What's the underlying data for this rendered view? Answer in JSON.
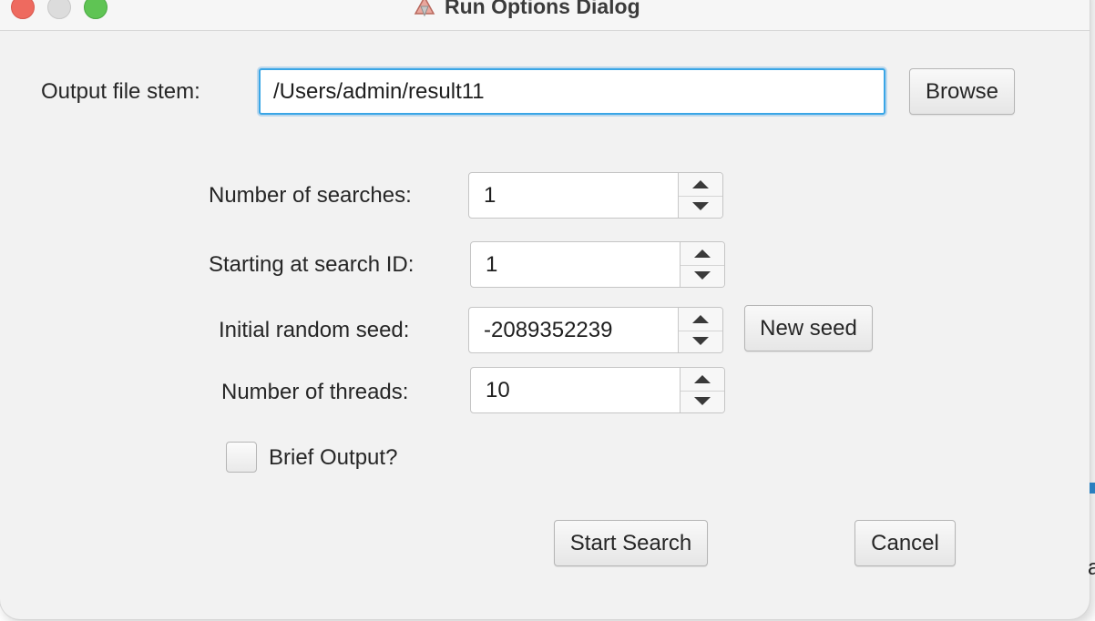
{
  "window": {
    "title": "Run Options Dialog",
    "title_icon": "dialog-app-icon"
  },
  "output_file_stem": {
    "label": "Output file stem:",
    "value": "/Users/admin/result11",
    "browse_label": "Browse"
  },
  "fields": {
    "num_searches": {
      "label": "Number of searches:",
      "value": "1"
    },
    "start_search_id": {
      "label": "Starting at search ID:",
      "value": "1"
    },
    "random_seed": {
      "label": "Initial random seed:",
      "value": "-2089352239",
      "new_seed_label": "New seed"
    },
    "num_threads": {
      "label": "Number of threads:",
      "value": "10"
    }
  },
  "brief_output": {
    "label": "Brief Output?",
    "checked": false
  },
  "actions": {
    "start_label": "Start Search",
    "cancel_label": "Cancel"
  },
  "edge_text": "a",
  "colors": {
    "focus_ring": "#3aa6e6",
    "close": "#ee6a5f",
    "minimize": "#dcdcdc",
    "zoom": "#5fc454"
  }
}
